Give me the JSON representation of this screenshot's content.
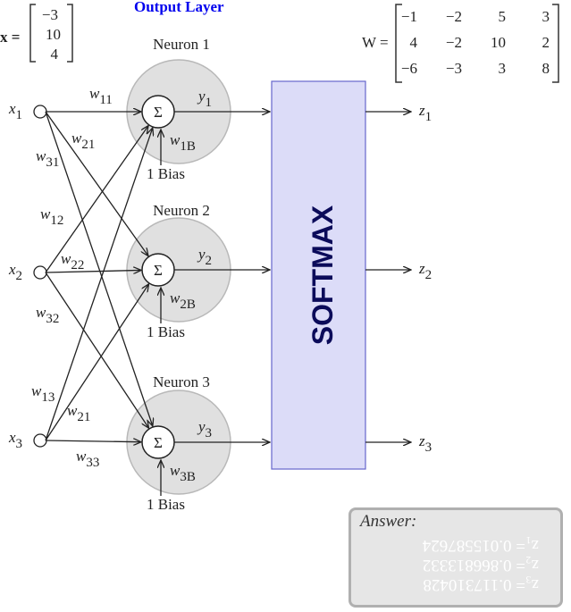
{
  "title": "Output Layer",
  "x_vector": {
    "label": "x =",
    "values": [
      "−3",
      "10",
      "4"
    ]
  },
  "W_matrix": {
    "label": "W =",
    "rows": [
      [
        "−1",
        "−2",
        "5",
        "3"
      ],
      [
        "4",
        "−2",
        "10",
        "2"
      ],
      [
        "−6",
        "−3",
        "3",
        "8"
      ]
    ]
  },
  "inputs": [
    {
      "name": "x",
      "sub": "1"
    },
    {
      "name": "x",
      "sub": "2"
    },
    {
      "name": "x",
      "sub": "3"
    }
  ],
  "neurons": [
    {
      "label": "Neuron 1",
      "sum": "Σ",
      "y": "y",
      "ysub": "1",
      "wb": "w",
      "wbsub": "1B",
      "bias": "1  Bias"
    },
    {
      "label": "Neuron 2",
      "sum": "Σ",
      "y": "y",
      "ysub": "2",
      "wb": "w",
      "wbsub": "2B",
      "bias": "1  Bias"
    },
    {
      "label": "Neuron 3",
      "sum": "Σ",
      "y": "y",
      "ysub": "3",
      "wb": "w",
      "wbsub": "3B",
      "bias": "1  Bias"
    }
  ],
  "weights": [
    {
      "w": "w",
      "sub": "11"
    },
    {
      "w": "w",
      "sub": "21"
    },
    {
      "w": "w",
      "sub": "31"
    },
    {
      "w": "w",
      "sub": "12"
    },
    {
      "w": "w",
      "sub": "22"
    },
    {
      "w": "w",
      "sub": "32"
    },
    {
      "w": "w",
      "sub": "13"
    },
    {
      "w": "w",
      "sub": "21"
    },
    {
      "w": "w",
      "sub": "33"
    }
  ],
  "softmax": {
    "label": "SOFTMAX",
    "fill": "#dcdcf8",
    "border": "#6666cc",
    "text_color": "#0b0b5a"
  },
  "outputs": [
    {
      "name": "z",
      "sub": "1"
    },
    {
      "name": "z",
      "sub": "2"
    },
    {
      "name": "z",
      "sub": "3"
    }
  ],
  "answer": {
    "title": "Answer:",
    "lines": [
      "z₃= 0.117310428",
      "z₂= 0.866813332",
      "z₁= 0.015587624"
    ]
  },
  "colors": {
    "title": "#0000ee",
    "neuron_fill": "#e0e0e0",
    "neuron_border": "#b8b8b8"
  }
}
